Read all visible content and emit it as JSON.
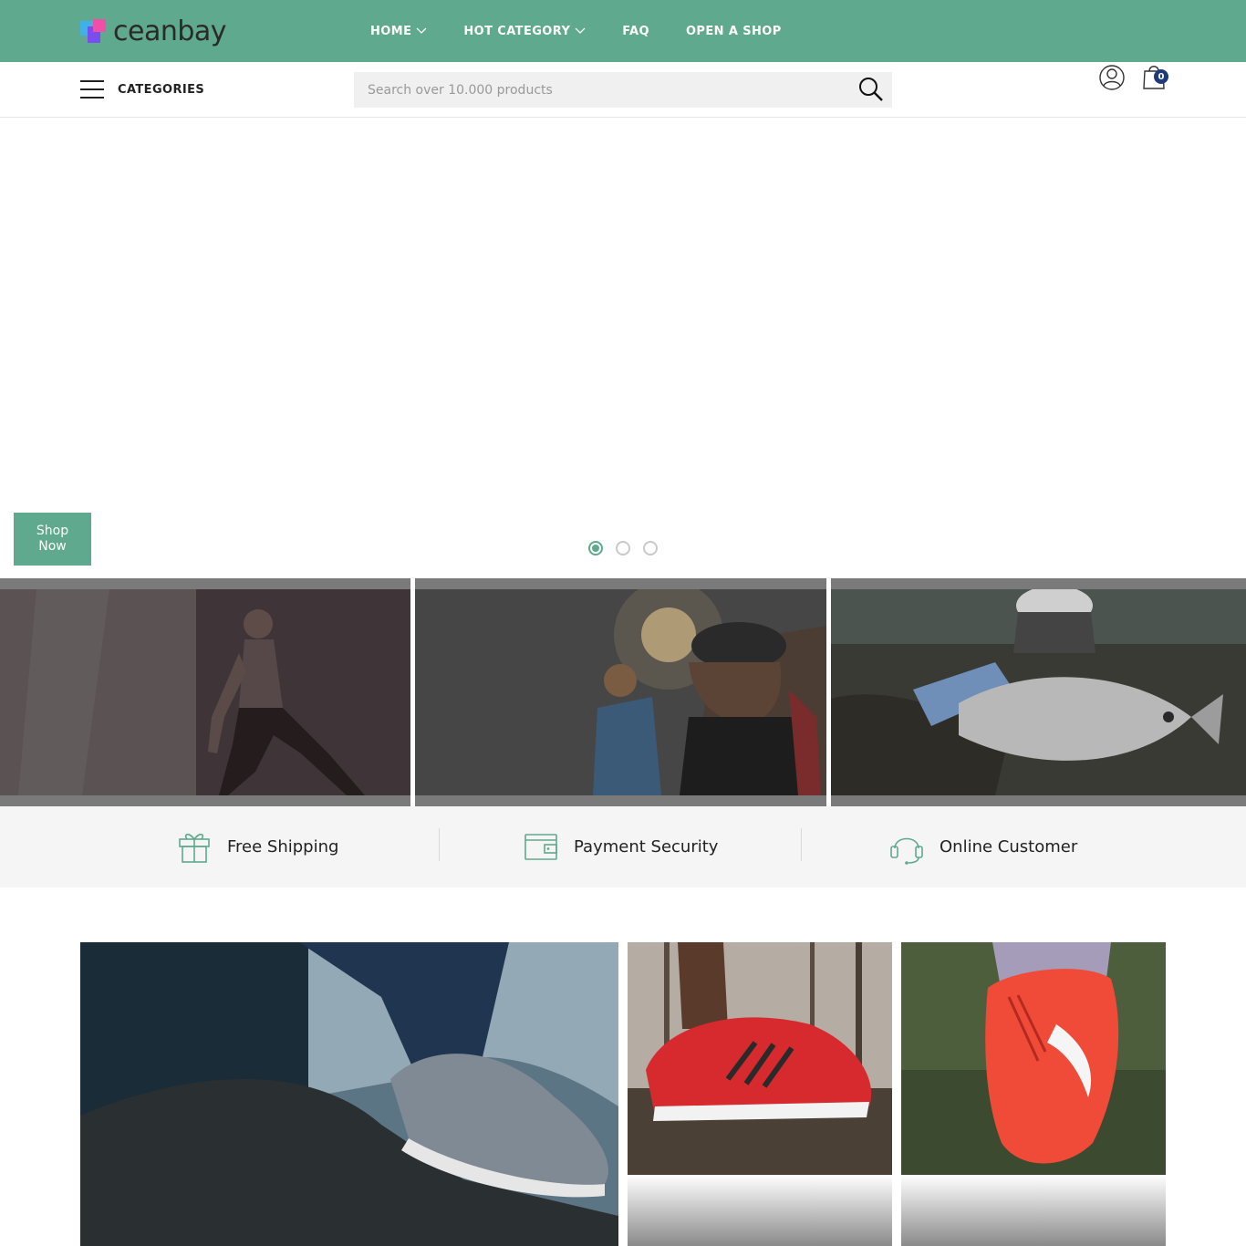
{
  "brand": {
    "name": "ceanbay"
  },
  "nav": {
    "items": [
      {
        "label": "HOME",
        "has_dropdown": true
      },
      {
        "label": "HOT CATEGORY",
        "has_dropdown": true
      },
      {
        "label": "FAQ",
        "has_dropdown": false
      },
      {
        "label": "OPEN A SHOP",
        "has_dropdown": false
      }
    ]
  },
  "subbar": {
    "categories_label": "CATEGORIES",
    "search": {
      "placeholder": "Search over 10.000 products",
      "value": ""
    },
    "cart_count": "0"
  },
  "hero": {
    "cta_label": "Shop Now",
    "slides_total": 3,
    "active_slide": 1
  },
  "features": [
    {
      "icon": "gift-icon",
      "label": "Free Shipping"
    },
    {
      "icon": "wallet-icon",
      "label": "Payment Security"
    },
    {
      "icon": "headset-icon",
      "label": "Online Customer"
    }
  ],
  "colors": {
    "brand_green": "#5fa98e",
    "badge_blue": "#1e3a7a",
    "feature_bg": "#f5f5f5"
  }
}
